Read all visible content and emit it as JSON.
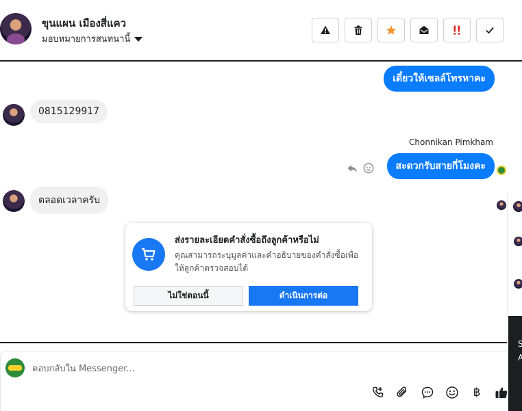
{
  "header": {
    "contact_name": "ขุนแผน เมืองสี่แคว",
    "assign_label": "มอบหมายการสนทนานี้",
    "actions": [
      {
        "icon": "warning-icon"
      },
      {
        "icon": "trash-icon"
      },
      {
        "icon": "star-icon",
        "color": "#f5922a"
      },
      {
        "icon": "mail-open-icon"
      },
      {
        "icon": "urgent-icon",
        "color": "#e02020"
      },
      {
        "icon": "check-icon"
      }
    ]
  },
  "messages": [
    {
      "direction": "out",
      "text": "เดี๋ยวให้เซลล์โทรหาคะ"
    },
    {
      "direction": "in",
      "text": "0815129917"
    },
    {
      "direction": "out",
      "sender": "Chonnikan Pimkham",
      "text": "สะดวกรับสายกี่โมงคะ"
    },
    {
      "direction": "in",
      "text": "ตลอดเวลาครับ"
    }
  ],
  "order_card": {
    "title": "ส่งรายละเอียดคำสั่งซื้อถึงลูกค้าหรือไม่",
    "description": "คุณสามารถระบุมูลค่าและคำอธิบายของคำสั่งซื้อเพื่อให้ลูกค้าตรวจสอบได้",
    "secondary_button": "ไม่ใช่ตอนนี้",
    "primary_button": "ดำเนินการต่อ"
  },
  "side_panel": {
    "line1": "S",
    "line2": "A"
  },
  "composer": {
    "placeholder": "ตอบกลับใน Messenger...",
    "value": "",
    "tools": [
      "call-icon",
      "attach-icon",
      "saved-reply-icon",
      "emoji-icon",
      "baht-icon",
      "thumbs-up-icon"
    ]
  },
  "colors": {
    "accent": "#0a7cff",
    "button_blue": "#1877f2"
  }
}
